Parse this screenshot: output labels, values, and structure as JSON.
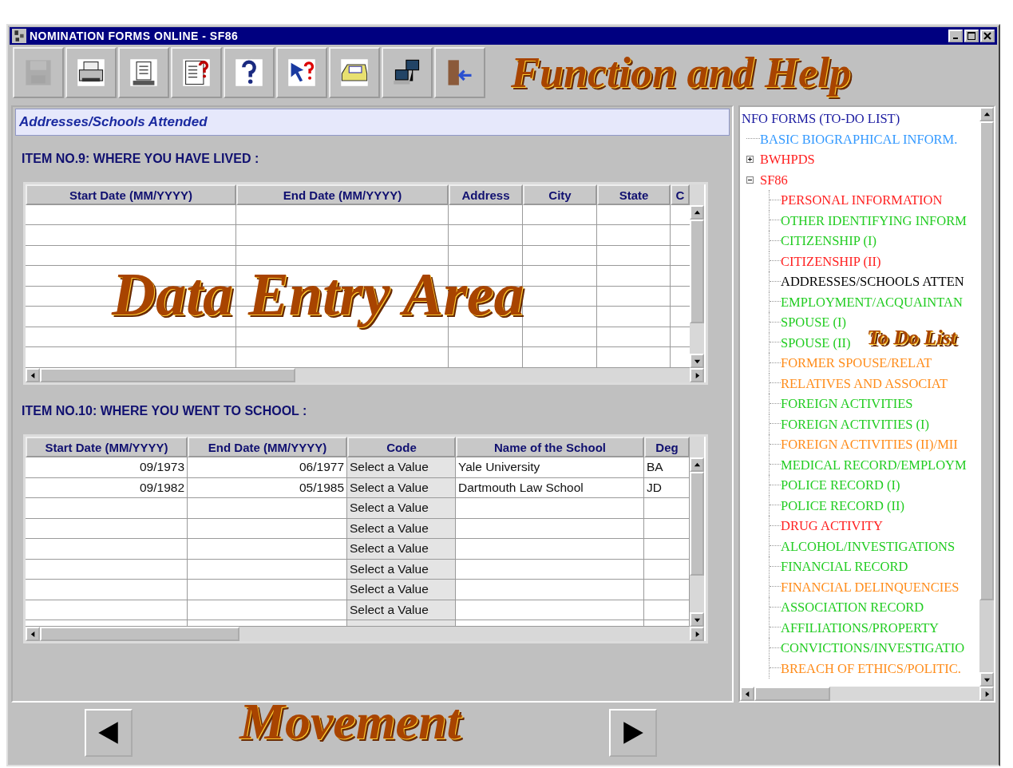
{
  "window": {
    "title": "NOMINATION FORMS ONLINE - SF86"
  },
  "toolbar": [
    {
      "kind": "save",
      "disabled": true
    },
    {
      "kind": "print",
      "disabled": false
    },
    {
      "kind": "form",
      "disabled": false
    },
    {
      "kind": "doc_help",
      "disabled": false
    },
    {
      "kind": "help",
      "disabled": false
    },
    {
      "kind": "pointer_help",
      "disabled": false
    },
    {
      "kind": "inbox",
      "disabled": false
    },
    {
      "kind": "network",
      "disabled": false
    },
    {
      "kind": "exit",
      "disabled": false
    }
  ],
  "section_title": "Addresses/Schools Attended",
  "residences": {
    "label": "ITEM  NO.9: WHERE YOU HAVE LIVED  :",
    "columns": [
      "Start Date (MM/YYYY)",
      "End Date (MM/YYYY)",
      "Address",
      "City",
      "State",
      "C"
    ]
  },
  "schools": {
    "label": "ITEM  NO.10: WHERE YOU WENT TO SCHOOL :",
    "columns": [
      "Start Date (MM/YYYY)",
      "End Date (MM/YYYY)",
      "Code",
      "Name of the School",
      "Deg"
    ],
    "rows": [
      {
        "start_date": "09/1973",
        "end_date": "06/1977",
        "code": "Select a Value",
        "school": "Yale University",
        "degree": "BA"
      },
      {
        "start_date": "09/1982",
        "end_date": "05/1985",
        "code": "Select a Value",
        "school": "Dartmouth Law School",
        "degree": "JD"
      },
      {
        "code": "Select a Value"
      },
      {
        "code": "Select a Value"
      },
      {
        "code": "Select a Value"
      },
      {
        "code": "Select a Value"
      },
      {
        "code": "Select a Value"
      },
      {
        "code": "Select a Value"
      }
    ]
  },
  "tree": {
    "label": "NFO FORMS (TO-DO LIST)",
    "color": "#1a1aa0",
    "children": [
      {
        "label": "BASIC BIOGRAPHICAL INFORM.",
        "color": "#3399ff"
      },
      {
        "label": "BWHPDS",
        "color": "#ff2020",
        "expanded": false
      },
      {
        "label": "SF86",
        "color": "#ff2020",
        "expanded": true,
        "children": [
          {
            "label": "PERSONAL INFORMATION",
            "color": "#ff2020"
          },
          {
            "label": "OTHER IDENTIFYING INFORM",
            "color": "#22cc22"
          },
          {
            "label": "CITIZENSHIP (I)",
            "color": "#22cc22"
          },
          {
            "label": "CITIZENSHIP (II)",
            "color": "#ff2020"
          },
          {
            "label": "ADDRESSES/SCHOOLS ATTEN",
            "color": "#000000"
          },
          {
            "label": "EMPLOYMENT/ACQUAINTAN",
            "color": "#22cc22"
          },
          {
            "label": "SPOUSE (I)",
            "color": "#22cc22"
          },
          {
            "label": "SPOUSE (II)",
            "color": "#22cc22"
          },
          {
            "label": "FORMER SPOUSE/RELAT",
            "color": "#ff8c1a"
          },
          {
            "label": "RELATIVES AND ASSOCIAT",
            "color": "#ff8c1a"
          },
          {
            "label": "FOREIGN ACTIVITIES",
            "color": "#22cc22"
          },
          {
            "label": "FOREIGN ACTIVITIES (I)",
            "color": "#22cc22"
          },
          {
            "label": "FOREIGN ACTIVITIES (II)/MII",
            "color": "#ff8c1a"
          },
          {
            "label": "MEDICAL RECORD/EMPLOYM",
            "color": "#22cc22"
          },
          {
            "label": "POLICE RECORD (I)",
            "color": "#22cc22"
          },
          {
            "label": "POLICE RECORD (II)",
            "color": "#22cc22"
          },
          {
            "label": "DRUG ACTIVITY",
            "color": "#ff2020"
          },
          {
            "label": "ALCOHOL/INVESTIGATIONS",
            "color": "#22cc22"
          },
          {
            "label": "FINANCIAL RECORD",
            "color": "#22cc22"
          },
          {
            "label": "FINANCIAL DELINQUENCIES",
            "color": "#ff8c1a"
          },
          {
            "label": "ASSOCIATION RECORD",
            "color": "#22cc22"
          },
          {
            "label": "AFFILIATIONS/PROPERTY",
            "color": "#22cc22"
          },
          {
            "label": "CONVICTIONS/INVESTIGATIO",
            "color": "#22cc22"
          },
          {
            "label": "BREACH OF ETHICS/POLITIC.",
            "color": "#ff8c1a"
          }
        ]
      }
    ]
  },
  "annotations": [
    {
      "kind": "help",
      "text": "Function and Help"
    },
    {
      "kind": "entry",
      "text": "Data Entry Area"
    },
    {
      "kind": "todo",
      "text": "To Do List"
    },
    {
      "kind": "movement",
      "text": "Movement"
    }
  ]
}
